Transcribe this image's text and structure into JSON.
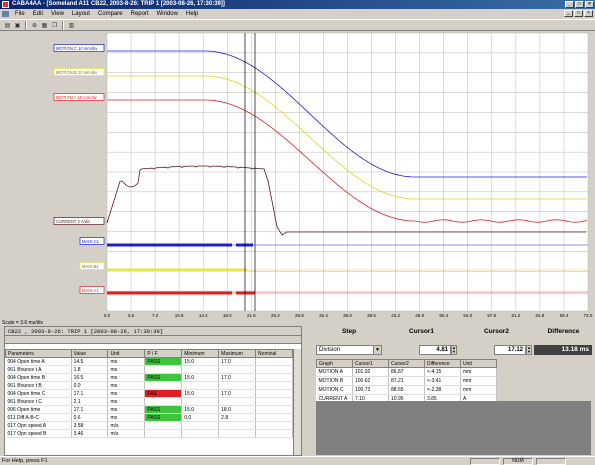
{
  "window": {
    "title": "CABA4AA - [Someland A11 CB22, 2003-8-26: TRIP 1 [2003-08-26, 17:30:39]]"
  },
  "menu": [
    "File",
    "Edit",
    "View",
    "Layout",
    "Compare",
    "Report",
    "Window",
    "Help"
  ],
  "toolbar_icons": [
    "open-icon",
    "save-icon",
    "zoom-icon",
    "print-icon",
    "copy-icon",
    "chart-icon"
  ],
  "chart": {
    "scale_info": "Scale = 3.6 ms/div",
    "channel_labels": [
      {
        "label": "MOTION C  10 mm/div",
        "color": "#2020d0"
      },
      {
        "label": "MOTION B  10 mm/div",
        "color": "#e8e840"
      },
      {
        "label": "MOTION A  10 mm/div",
        "color": "#e02020"
      },
      {
        "label": "CURRENT  2 A/div",
        "color": "#5a1a1a"
      },
      {
        "label": "MAIN C1",
        "color": "#2020d0"
      },
      {
        "label": "MAIN B1",
        "color": "#e8e840"
      },
      {
        "label": "MAIN A1",
        "color": "#e02020"
      }
    ]
  },
  "chart_data": {
    "type": "line",
    "x_ticks": [
      "0.0",
      "3.6",
      "7.2",
      "10.8",
      "14.4",
      "18.0",
      "21.6",
      "25.2",
      "28.8",
      "32.4",
      "36.0",
      "39.6",
      "43.2",
      "46.8",
      "50.4",
      "54.0",
      "57.6",
      "61.2",
      "64.8",
      "68.4",
      "72.0"
    ],
    "xlim": [
      0,
      72
    ],
    "grid": true,
    "cursor1": 4.81,
    "cursor2": 17.12,
    "series": [
      {
        "name": "MOTION C",
        "color": "#2020d0"
      },
      {
        "name": "MOTION B",
        "color": "#e8e840"
      },
      {
        "name": "MOTION A",
        "color": "#e02020"
      },
      {
        "name": "CURRENT",
        "color": "#5a1a1a"
      },
      {
        "name": "MAIN C1",
        "color": "#2020d0"
      },
      {
        "name": "MAIN B1",
        "color": "#e8e840"
      },
      {
        "name": "MAIN A1",
        "color": "#e02020"
      }
    ]
  },
  "params_panel": {
    "header": "CB22 , 2003-8-26: TRIP 1 [2003-08-26, 17:30:39]",
    "columns": [
      "Parameters",
      "Value",
      "Unit",
      "P / F",
      "Minimum",
      "Maximum",
      "Nominal"
    ],
    "rows": [
      {
        "id": "004",
        "name": "Open time A",
        "value": "14.5",
        "unit": "ms",
        "pf": "PASS",
        "min": "15.0",
        "max": "17.0",
        "nom": ""
      },
      {
        "id": "061",
        "name": "Bounce t  A",
        "value": "1.8",
        "unit": "ms",
        "pf": "",
        "min": "",
        "max": "",
        "nom": ""
      },
      {
        "id": "004",
        "name": "Open time B",
        "value": "16.5",
        "unit": "ms",
        "pf": "PASS",
        "min": "15.0",
        "max": "17.0",
        "nom": ""
      },
      {
        "id": "061",
        "name": "Bounce t  B",
        "value": "0.0",
        "unit": "ms",
        "pf": "",
        "min": "",
        "max": "",
        "nom": ""
      },
      {
        "id": "004",
        "name": "Open time  C",
        "value": "17.1",
        "unit": "ms",
        "pf": "FAIL",
        "min": "15.0",
        "max": "17.0",
        "nom": ""
      },
      {
        "id": "061",
        "name": "Bounce t  C",
        "value": "2.1",
        "unit": "ms",
        "pf": "",
        "min": "",
        "max": "",
        "nom": ""
      },
      {
        "id": "006",
        "name": "Open time",
        "value": "17.1",
        "unit": "ms",
        "pf": "PASS",
        "min": "15.0",
        "max": "18.0",
        "nom": ""
      },
      {
        "id": "011",
        "name": "Diff A-B-C",
        "value": "0.6",
        "unit": "ms",
        "pf": "PASS",
        "min": "0.0",
        "max": "2.8",
        "nom": ""
      },
      {
        "id": "017",
        "name": "Opn speed  A",
        "value": "3.58",
        "unit": "m/s",
        "pf": "",
        "min": "",
        "max": "",
        "nom": ""
      },
      {
        "id": "017",
        "name": "Opn speed  B",
        "value": "3.46",
        "unit": "m/s",
        "pf": "",
        "min": "",
        "max": "",
        "nom": ""
      }
    ]
  },
  "cursor_panel": {
    "step_label": "Step",
    "cursor1_label": "Cursor1",
    "cursor2_label": "Cursor2",
    "difference_label": "Difference",
    "step_value": "Division",
    "cursor1_value": "4.81",
    "cursor2_value": "17.12",
    "difference_value": "13.18 ms",
    "columns": [
      "Graph",
      "Cursor1",
      "Cursor2",
      "Difference",
      "Unit"
    ],
    "rows": [
      {
        "graph": "MOTION A",
        "c1": "101.02",
        "c2": "86.87",
        "diff": "<-4.15",
        "unit": "mm"
      },
      {
        "graph": "MOTION B",
        "c1": "100.62",
        "c2": "87.21",
        "diff": "<-3.41",
        "unit": "mm"
      },
      {
        "graph": "MOTION C",
        "c1": "100.73",
        "c2": "88.65",
        "diff": "<-2.38",
        "unit": "mm"
      },
      {
        "graph": "CURRENT  A",
        "c1": "7.10",
        "c2": "10.95",
        "diff": "3.85",
        "unit": "A"
      }
    ]
  },
  "status": {
    "text": "For Help, press F1",
    "num": "NUM"
  }
}
